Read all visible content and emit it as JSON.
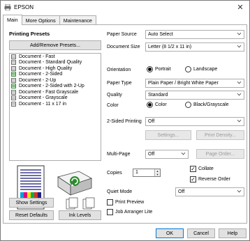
{
  "window": {
    "title": "EPSON",
    "close_glyph": "✕"
  },
  "tabs": [
    {
      "label": "Main",
      "active": true
    },
    {
      "label": "More Options",
      "active": false
    },
    {
      "label": "Maintenance",
      "active": false
    }
  ],
  "presets": {
    "title": "Printing Presets",
    "add_remove_label": "Add/Remove Presets...",
    "items": [
      {
        "label": "Document - Fast",
        "icon": "document-icon"
      },
      {
        "label": "Document - Standard Quality",
        "icon": "document-icon"
      },
      {
        "label": "Document - High Quality",
        "icon": "document-icon"
      },
      {
        "label": "Document - 2-Sided",
        "icon": "two-sided-document-icon"
      },
      {
        "label": "Document - 2-Up",
        "icon": "document-icon"
      },
      {
        "label": "Document - 2-Sided with 2-Up",
        "icon": "two-sided-document-icon"
      },
      {
        "label": "Document - Fast Grayscale",
        "icon": "document-icon"
      },
      {
        "label": "Document - Grayscale",
        "icon": "document-icon"
      },
      {
        "label": "Document - 11 x 17 in",
        "icon": "document-icon"
      }
    ]
  },
  "left_buttons": {
    "show_settings": "Show Settings",
    "reset_defaults": "Reset Defaults",
    "ink_levels": "Ink Levels"
  },
  "settings": {
    "paper_source": {
      "label": "Paper Source",
      "value": "Auto Select"
    },
    "document_size": {
      "label": "Document Size",
      "value": "Letter (8 1/2 x 11 in)"
    },
    "orientation": {
      "label": "Orientation",
      "portrait": "Portrait",
      "landscape": "Landscape",
      "selected": "Portrait"
    },
    "paper_type": {
      "label": "Paper Type",
      "value": "Plain Paper / Bright White Paper"
    },
    "quality": {
      "label": "Quality",
      "value": "Standard"
    },
    "color": {
      "label": "Color",
      "color_option": "Color",
      "bw_option": "Black/Grayscale",
      "selected": "Color"
    },
    "two_sided": {
      "label": "2-Sided Printing",
      "value": "Off",
      "settings_btn": "Settings...",
      "density_btn": "Print Density..."
    },
    "multi_page": {
      "label": "Multi-Page",
      "value": "Off",
      "page_order_btn": "Page Order..."
    },
    "copies": {
      "label": "Copies",
      "value": "1",
      "collate": "Collate",
      "collate_checked": true,
      "reverse_order": "Reverse Order",
      "reverse_checked": true
    },
    "quiet_mode": {
      "label": "Quiet Mode",
      "value": "Off"
    },
    "print_preview": {
      "label": "Print Preview",
      "checked": false
    },
    "job_arranger": {
      "label": "Job Arranger Lite",
      "checked": false
    }
  },
  "footer": {
    "ok": "OK",
    "cancel": "Cancel",
    "help": "Help"
  },
  "colors": {
    "accent": "#0078d7",
    "border": "#adadad",
    "button_bg": "#e1e1e1"
  }
}
